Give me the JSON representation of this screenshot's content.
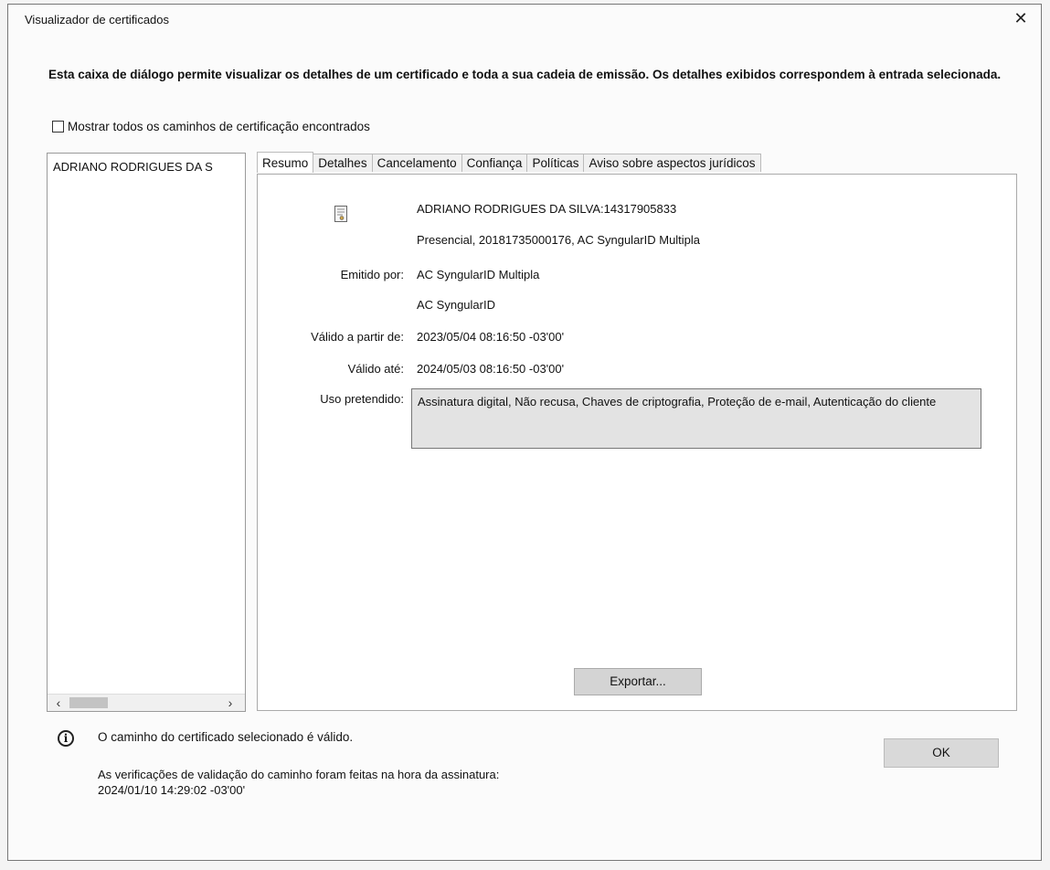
{
  "window": {
    "title": "Visualizador de certificados",
    "close_label": "✕"
  },
  "description": "Esta caixa de diálogo permite visualizar os detalhes de um certificado e toda a sua cadeia de emissão. Os detalhes exibidos correspondem à entrada selecionada.",
  "show_all_paths": {
    "label": "Mostrar todos os caminhos de certificação encontrados",
    "checked": false
  },
  "tree": {
    "items": [
      "ADRIANO RODRIGUES DA S"
    ],
    "scroll_left": "‹",
    "scroll_right": "›"
  },
  "tabs": [
    {
      "label": "Resumo",
      "active": true
    },
    {
      "label": "Detalhes",
      "active": false
    },
    {
      "label": "Cancelamento",
      "active": false
    },
    {
      "label": "Confiança",
      "active": false
    },
    {
      "label": "Políticas",
      "active": false
    },
    {
      "label": "Aviso sobre aspectos jurídicos",
      "active": false
    }
  ],
  "summary": {
    "subject_name": "ADRIANO RODRIGUES DA SILVA:14317905833",
    "subject_details": "Presencial, 20181735000176, AC SyngularID Multipla",
    "issued_by_label": "Emitido por:",
    "issued_by_1": "AC SyngularID Multipla",
    "issued_by_2": "AC SyngularID",
    "valid_from_label": "Válido a partir de:",
    "valid_from": "2023/05/04 08:16:50 -03'00'",
    "valid_to_label": "Válido até:",
    "valid_to": "2024/05/03 08:16:50 -03'00'",
    "intended_use_label": "Uso pretendido:",
    "intended_use": "Assinatura digital, Não recusa, Chaves de criptografia, Proteção de e-mail, Autenticação do cliente",
    "export_label": "Exportar..."
  },
  "status": {
    "icon": "info-icon",
    "valid_message": "O caminho do certificado selecionado é válido.",
    "check_message": "As verificações de validação do caminho foram feitas na hora da assinatura:",
    "check_time": "2024/01/10 14:29:02 -03'00'"
  },
  "ok_label": "OK"
}
